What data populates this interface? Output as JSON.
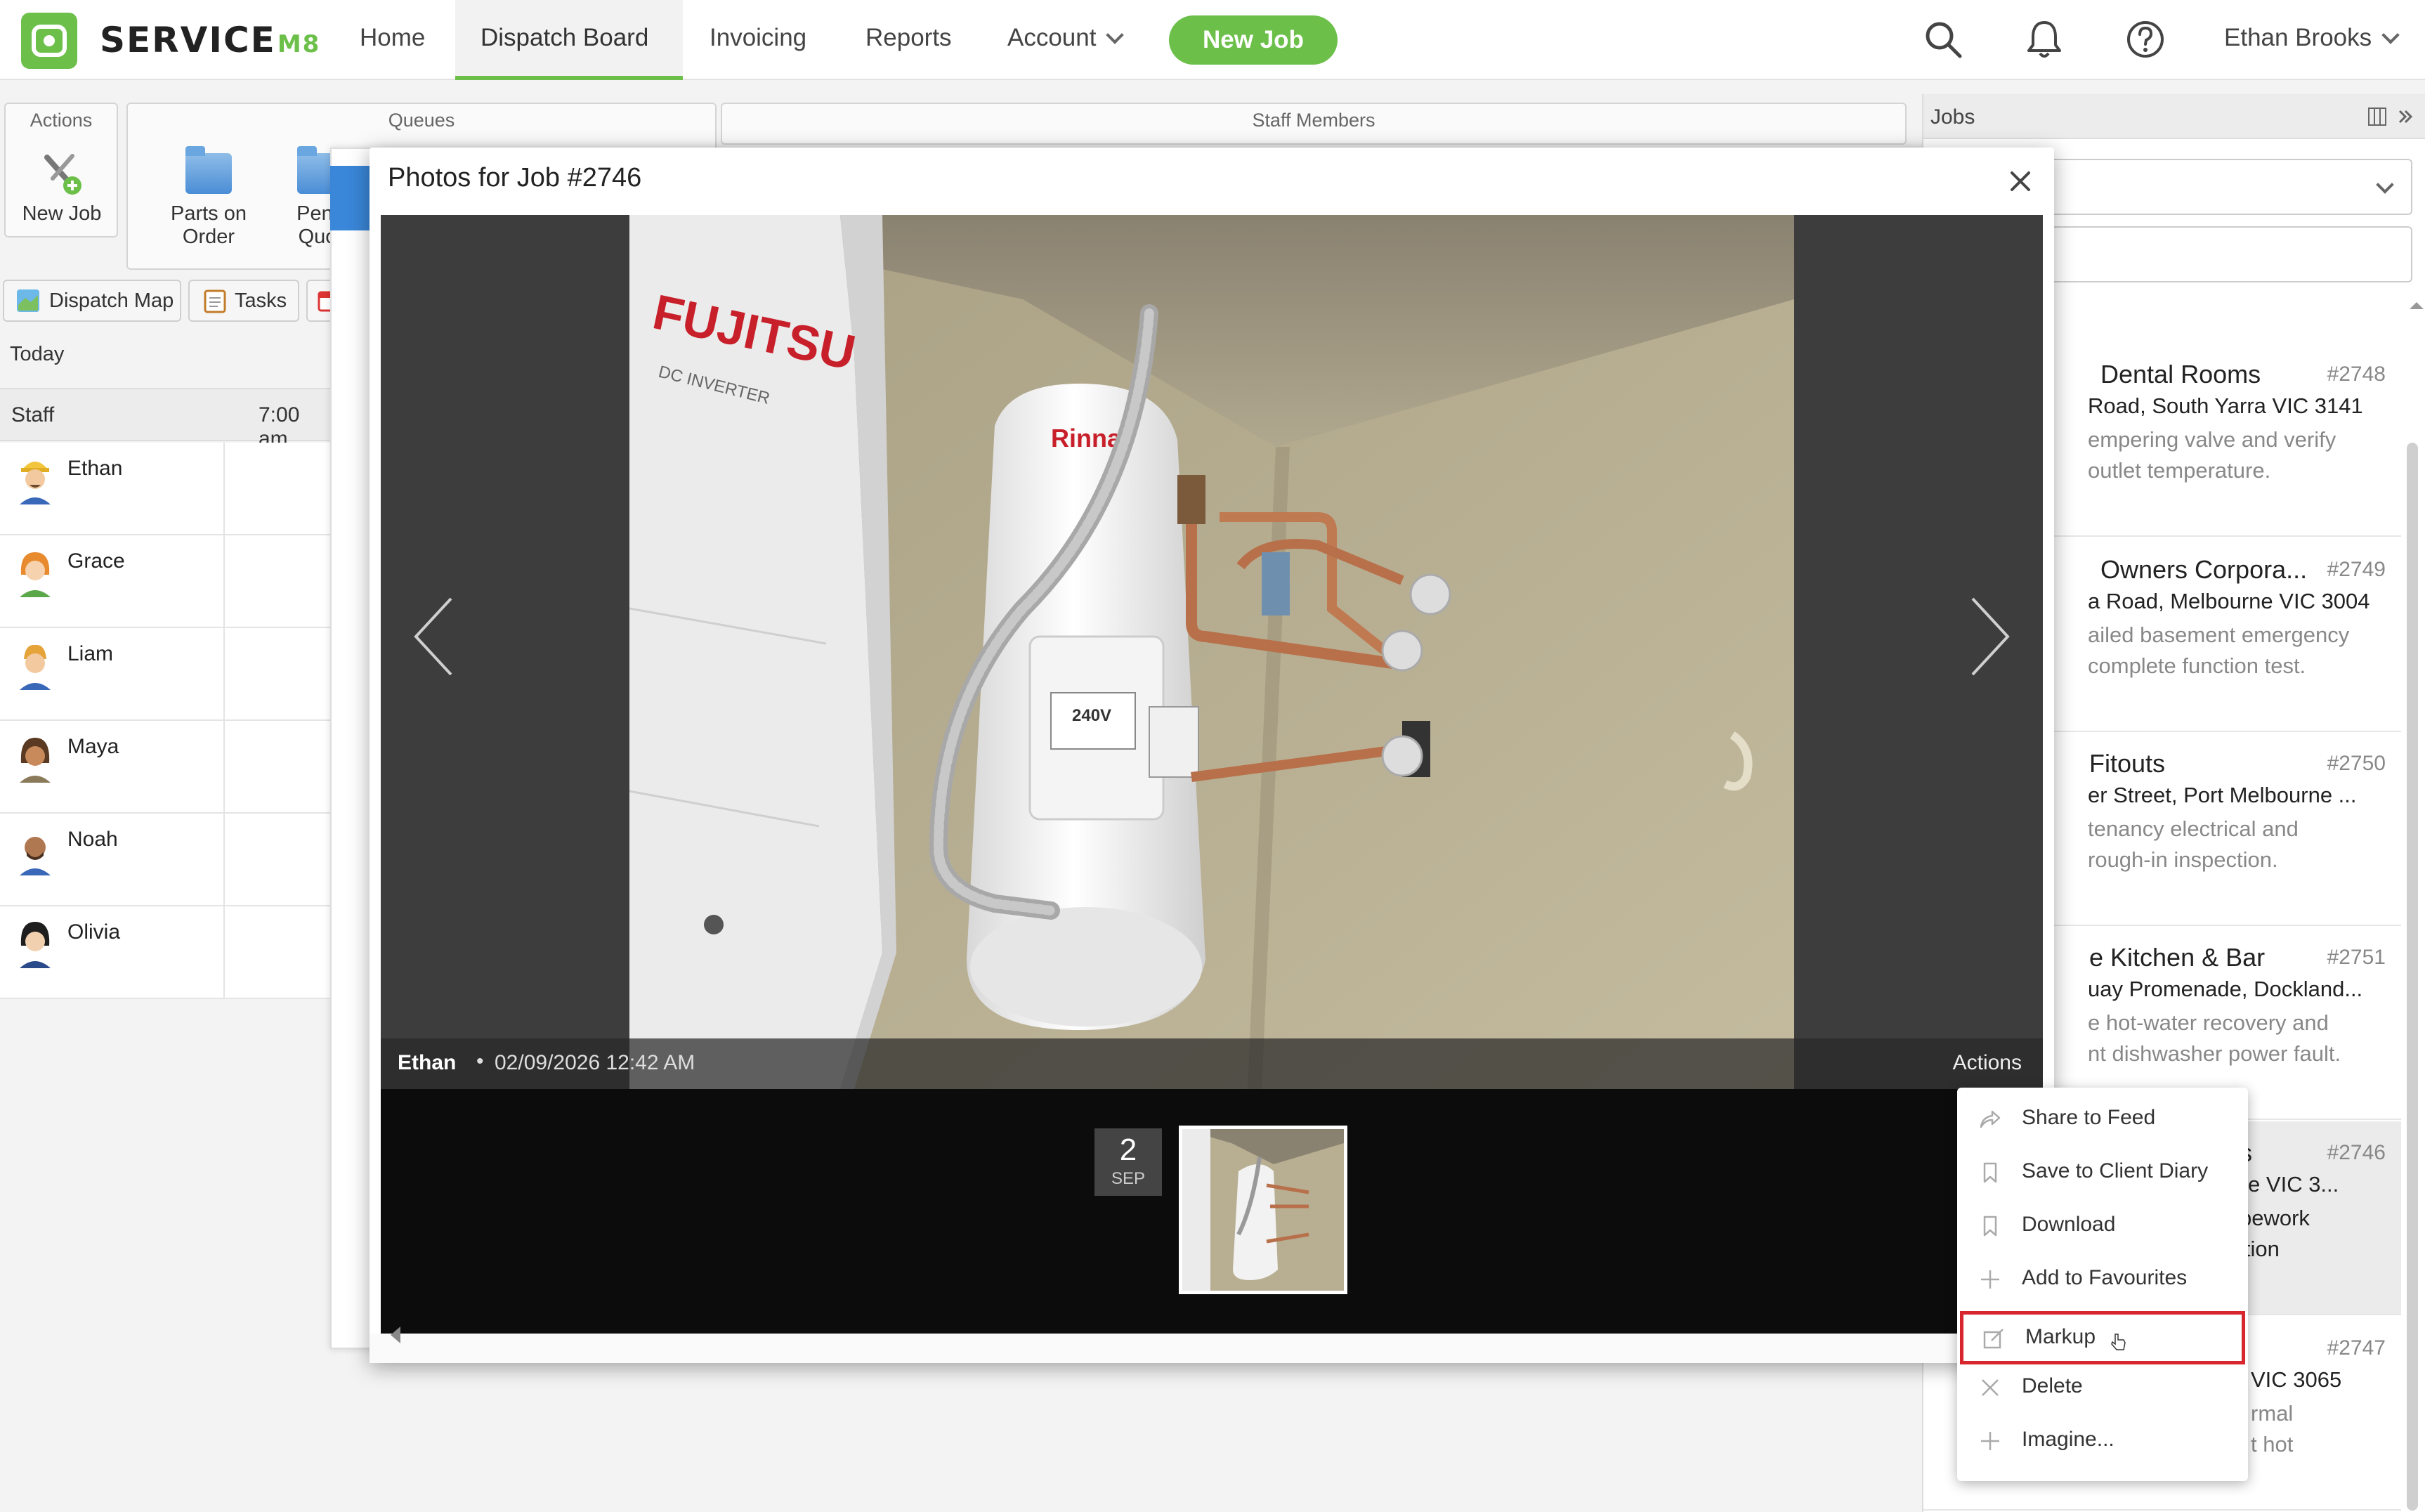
{
  "nav": {
    "brand": "SERVICE",
    "brand_suffix": "M8",
    "items": [
      {
        "label": "Home"
      },
      {
        "label": "Dispatch Board"
      },
      {
        "label": "Invoicing"
      },
      {
        "label": "Reports"
      },
      {
        "label": "Account"
      }
    ],
    "new_job": "New Job",
    "user": "Ethan Brooks",
    "accent": "#6cc04a"
  },
  "ribbon": {
    "actions_title": "Actions",
    "queues_title": "Queues",
    "staff_title": "Staff Members",
    "new_job": "New Job",
    "parts_line1": "Parts on",
    "parts_line2": "Order",
    "pending_line1": "Pend",
    "pending_line2": "Quot"
  },
  "tabs": {
    "dispatch_map": "Dispatch Map",
    "tasks": "Tasks"
  },
  "today": "Today",
  "staff": {
    "col_staff": "Staff",
    "col_time": "7:00 am",
    "people": [
      "Ethan",
      "Grace",
      "Liam",
      "Maya",
      "Noah",
      "Olivia"
    ]
  },
  "jobs_panel": {
    "title": "Jobs",
    "cards": [
      {
        "title": "Dental Rooms",
        "number": "#2748",
        "address": "Road, South Yarra VIC 3141",
        "desc1": "empering valve and verify",
        "desc2": "outlet temperature."
      },
      {
        "title": "Owners Corpora...",
        "number": "#2749",
        "address": "a Road, Melbourne VIC 3004",
        "desc1": "ailed basement emergency",
        "desc2": "complete function test."
      },
      {
        "title": "Fitouts",
        "number": "#2750",
        "address": "er Street, Port Melbourne ...",
        "desc1": "tenancy electrical and",
        "desc2": "rough-in inspection."
      },
      {
        "title": "e Kitchen & Bar",
        "number": "#2751",
        "address": "uay Promenade, Dockland...",
        "desc1": "e hot-water recovery and",
        "desc2": "nt dishwasher power fault."
      },
      {
        "title": "ents",
        "number": "#2746",
        "address": "ourne VIC 3...",
        "desc1": "e pipework",
        "desc2": "solation"
      },
      {
        "title": "",
        "number": "#2747",
        "address": "VIC 3065",
        "desc1": "rmal",
        "desc2": "t hot"
      }
    ]
  },
  "modal": {
    "title": "Photos for Job #2746",
    "caption_name": "Ethan",
    "caption_sep": "•",
    "caption_date": "02/09/2026 12:42 AM",
    "caption_actions": "Actions",
    "badge_day": "2",
    "badge_month": "SEP",
    "photo_brand": "FUJITSU",
    "photo_sub": "DC INVERTER",
    "tank_brand": "Rinnai",
    "tank_label": "240V"
  },
  "context_menu": {
    "items": [
      {
        "label": "Share to Feed",
        "icon": "share-icon"
      },
      {
        "label": "Save to Client Diary",
        "icon": "bookmark-icon"
      },
      {
        "label": "Download",
        "icon": "bookmark-icon"
      },
      {
        "label": "Add to Favourites",
        "icon": "plus-icon"
      },
      {
        "label": "Markup",
        "icon": "markup-icon"
      },
      {
        "label": "Delete",
        "icon": "close-icon"
      },
      {
        "label": "Imagine...",
        "icon": "plus-icon"
      }
    ],
    "highlight_color": "#d7262e"
  }
}
